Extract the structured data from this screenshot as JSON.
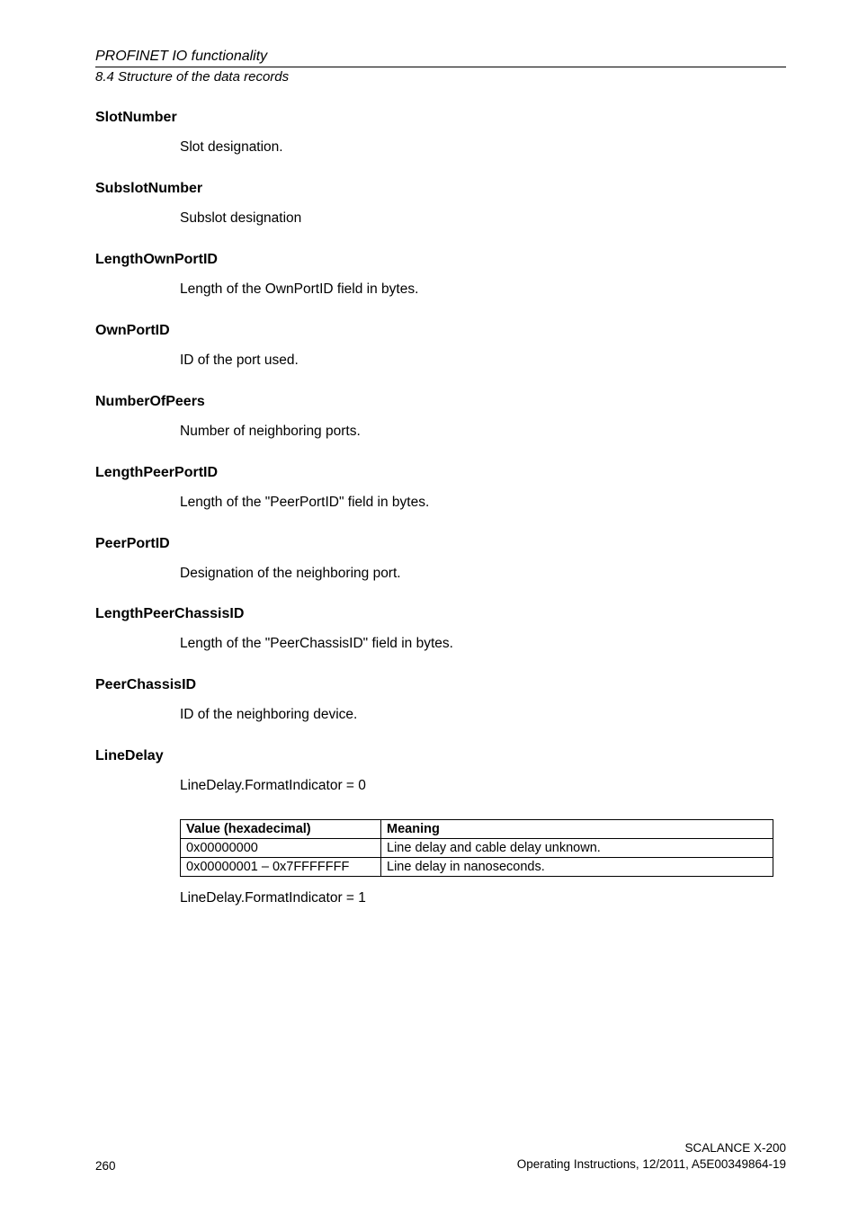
{
  "header": {
    "running_title": "PROFINET IO functionality",
    "sub_running": "8.4 Structure of the data records"
  },
  "sections": {
    "slotnumber": {
      "heading": "SlotNumber",
      "body": "Slot designation."
    },
    "subslotnumber": {
      "heading": "SubslotNumber",
      "body": "Subslot designation"
    },
    "lengthownportid": {
      "heading": "LengthOwnPortID",
      "body": "Length of the OwnPortID field in bytes."
    },
    "ownportid": {
      "heading": "OwnPortID",
      "body": "ID of the port used."
    },
    "numberofpeers": {
      "heading": "NumberOfPeers",
      "body": "Number of neighboring ports."
    },
    "lengthpeerportid": {
      "heading": "LengthPeerPortID",
      "body": "Length of the \"PeerPortID\" field in bytes."
    },
    "peerportid": {
      "heading": "PeerPortID",
      "body": "Designation of the neighboring port."
    },
    "lengthpeerchassisid": {
      "heading": "LengthPeerChassisID",
      "body": "Length of the \"PeerChassisID\" field in bytes."
    },
    "peerchassisid": {
      "heading": "PeerChassisID",
      "body": "ID of the neighboring device."
    },
    "linedelay": {
      "heading": "LineDelay",
      "intro0": "LineDelay.FormatIndicator = 0",
      "outro1": "LineDelay.FormatIndicator = 1",
      "table": {
        "head_value": "Value (hexadecimal)",
        "head_meaning": "Meaning",
        "rows": [
          {
            "value": "0x00000000",
            "meaning": "Line delay and cable delay unknown."
          },
          {
            "value": "0x00000001 – 0x7FFFFFFF",
            "meaning": "Line delay in nanoseconds."
          }
        ]
      }
    }
  },
  "footer": {
    "page": "260",
    "product": "SCALANCE X-200",
    "docinfo": "Operating Instructions, 12/2011, A5E00349864-19"
  }
}
